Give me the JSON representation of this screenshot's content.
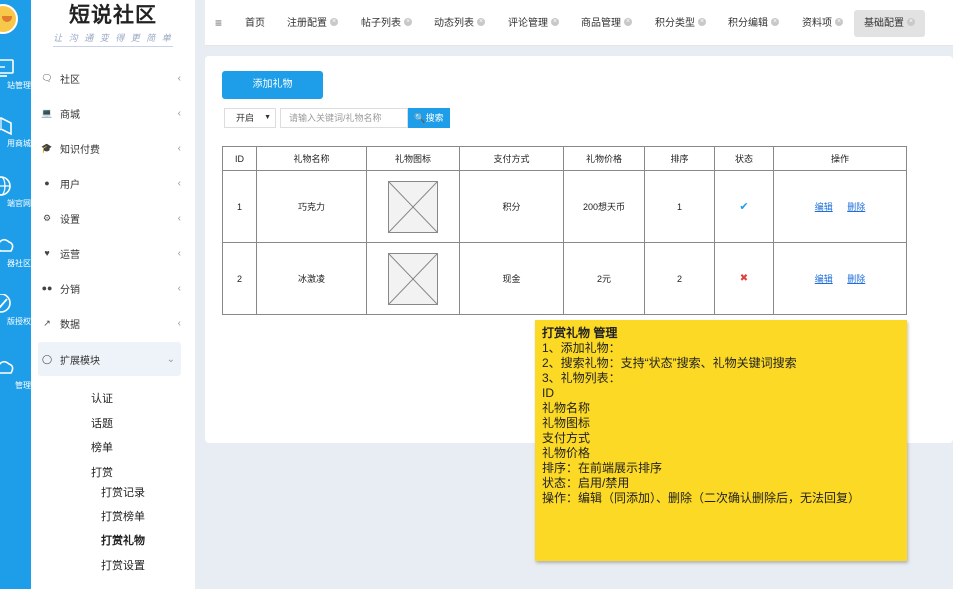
{
  "rail": {
    "items": [
      {
        "label": "站管理",
        "icon": "monitor-icon"
      },
      {
        "label": "用商城",
        "icon": "box-icon"
      },
      {
        "label": "端官网",
        "icon": "globe-icon"
      },
      {
        "label": "器社区",
        "icon": "cloud-chat-icon"
      },
      {
        "label": "版授权",
        "icon": "badge-check-icon"
      },
      {
        "label": "管理",
        "icon": "cloud-icon"
      }
    ]
  },
  "logo": {
    "title": "短说社区",
    "subtitle": "让 沟 通 变 得 更 简 单"
  },
  "sidebar": {
    "items": [
      {
        "label": "社区",
        "icon": "chat-icon"
      },
      {
        "label": "商城",
        "icon": "laptop-icon"
      },
      {
        "label": "知识付费",
        "icon": "graduation-cap-icon"
      },
      {
        "label": "用户",
        "icon": "user-icon"
      },
      {
        "label": "设置",
        "icon": "gear-icon"
      },
      {
        "label": "运营",
        "icon": "heart-icon"
      },
      {
        "label": "分销",
        "icon": "users-icon"
      },
      {
        "label": "数据",
        "icon": "line-chart-icon"
      },
      {
        "label": "扩展模块",
        "icon": "puzzle-icon"
      }
    ],
    "sub_items": [
      "认证",
      "话题",
      "榜单",
      "打赏"
    ],
    "sub_sub_items": [
      "打赏记录",
      "打赏榜单",
      "打赏礼物",
      "打赏设置"
    ]
  },
  "topbar": {
    "tabs": [
      "首页",
      "注册配置",
      "帖子列表",
      "动态列表",
      "评论管理",
      "商品管理",
      "积分类型",
      "积分编辑",
      "资料项",
      "基础配置"
    ]
  },
  "content": {
    "add_button": "添加礼物",
    "status_select": "开启",
    "search_placeholder": "请输入关键词/礼物名称",
    "search_button": "搜索",
    "table": {
      "headers": [
        "ID",
        "礼物名称",
        "礼物图标",
        "支付方式",
        "礼物价格",
        "排序",
        "状态",
        "操作"
      ],
      "rows": [
        {
          "id": "1",
          "name": "巧克力",
          "pay": "积分",
          "price": "200想天币",
          "sort": "1",
          "status": "enabled",
          "edit": "编辑",
          "delete": "删除"
        },
        {
          "id": "2",
          "name": "冰激凌",
          "pay": "现金",
          "price": "2元",
          "sort": "2",
          "status": "disabled",
          "edit": "编辑",
          "delete": "删除"
        }
      ]
    }
  },
  "note": {
    "title": "打赏礼物 管理",
    "lines": [
      "1、添加礼物：",
      "2、搜索礼物：支持“状态”搜索、礼物关键词搜索",
      "3、礼物列表：",
      "ID",
      "礼物名称",
      "礼物图标",
      "支付方式",
      "礼物价格",
      "排序：在前端展示排序",
      "状态：启用/禁用",
      "操作：编辑（同添加）、删除（二次确认删除后，无法回复）"
    ]
  },
  "colors": {
    "accent": "#1e9ee8",
    "note": "#fcd924",
    "enabled": "#1e9ee8",
    "disabled": "#e04040"
  }
}
